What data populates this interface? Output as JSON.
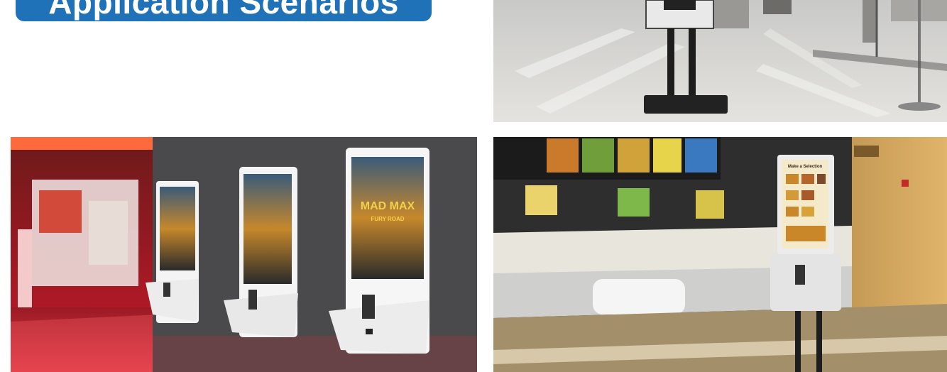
{
  "banner": {
    "title": "Application Scenarios"
  },
  "scenes": {
    "mall": {
      "kiosk_label": "MAD MAX",
      "kiosk_sub": "FURY ROAD"
    },
    "restaurant": {
      "menu_title": "Make a Selection"
    }
  },
  "colors": {
    "banner_blue": "#1f71b8",
    "wall_grey": "#4a4a4c",
    "cinema_red": "#c9182b",
    "wood": "#c59a55"
  }
}
